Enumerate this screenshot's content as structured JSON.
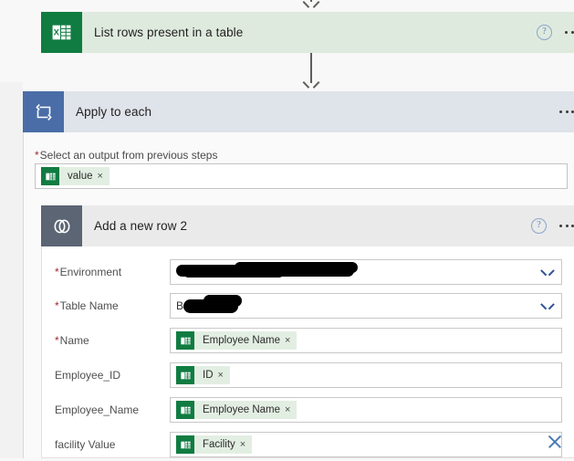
{
  "flow": {
    "excel_step": {
      "title": "List rows present in a table",
      "icon": "excel-icon",
      "color": "#107c41",
      "header_bg": "#dfeade",
      "help_label": "?",
      "menu_label": "more-commands"
    },
    "loop_step": {
      "title": "Apply to each",
      "icon": "apply-to-each-icon",
      "color": "#4a6da7",
      "header_bg": "#dfe3ea",
      "output_field": {
        "label": "Select an output from previous steps",
        "required": true,
        "token": {
          "text": "value",
          "icon": "excel-icon",
          "remove": "×"
        }
      }
    },
    "dataverse_step": {
      "title": "Add a new row 2",
      "icon": "dataverse-icon",
      "color": "#5b6573",
      "header_bg": "#eaeaea",
      "help_label": "?",
      "fields": [
        {
          "label": "Environment",
          "required": true,
          "control": "dropdown",
          "value": "",
          "redacted": true,
          "chevron": "chevron-down-icon"
        },
        {
          "label": "Table Name",
          "required": true,
          "control": "dropdown",
          "value": "B",
          "redacted": true,
          "chevron": "chevron-down-icon"
        },
        {
          "label": "Name",
          "required": true,
          "control": "token",
          "token": {
            "text": "Employee Name",
            "icon": "excel-icon",
            "remove": "×"
          }
        },
        {
          "label": "Employee_ID",
          "required": false,
          "control": "token",
          "token": {
            "text": "ID",
            "icon": "excel-icon",
            "remove": "×"
          }
        },
        {
          "label": "Employee_Name",
          "required": false,
          "control": "token",
          "token": {
            "text": "Employee Name",
            "icon": "excel-icon",
            "remove": "×"
          }
        },
        {
          "label": "facility Value",
          "required": false,
          "control": "token",
          "token": {
            "text": "Facility",
            "icon": "excel-icon",
            "remove": "×"
          },
          "clear_button": "clear-icon"
        }
      ]
    }
  },
  "symbols": {
    "required_mark": "*",
    "remove": "×"
  }
}
